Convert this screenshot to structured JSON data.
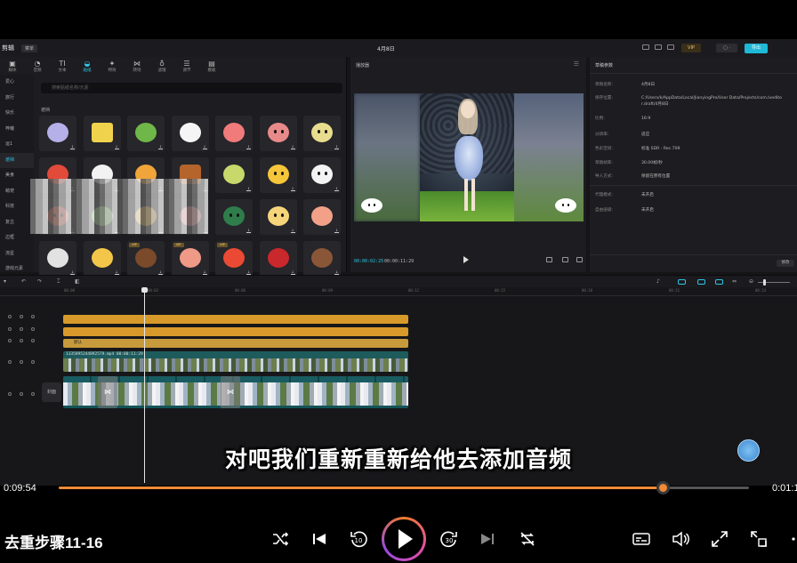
{
  "editor": {
    "app_name": "剪辑",
    "menu_chip": "菜单",
    "project_name": "4月8日",
    "vip_label": "VIP",
    "export_label": "导出",
    "asset_tabs": [
      "媒体",
      "音频",
      "文本",
      "贴纸",
      "特效",
      "转场",
      "滤镜",
      "调节",
      "模板"
    ],
    "asset_side": [
      "爱心",
      "旅行",
      "快乐",
      "梓曦",
      "运1",
      "遮挡",
      "美食",
      "萌宠",
      "科技",
      "复古",
      "边框",
      "流星",
      "游戏元素"
    ],
    "asset_section": "遮挡",
    "asset_search_placeholder": "搜索贴纸名称/元素",
    "player_header": "播放器",
    "player_time_current": "00:00:02:25",
    "player_time_total": "00:00:11:29",
    "props_header": "草稿参数",
    "props": [
      {
        "k": "草稿名称:",
        "v": "4月8日"
      },
      {
        "k": "保存位置:",
        "v": "C:/Users/k/AppData/Local/JianyingPro/User Data/Projects/com.lveditor.draft/4月8日"
      },
      {
        "k": "比例:",
        "v": "16:9"
      },
      {
        "k": "分辨率:",
        "v": "适应"
      },
      {
        "k": "色彩空间:",
        "v": "标准 SDR - Rec.709"
      },
      {
        "k": "草稿帧率:",
        "v": "30.00帧/秒"
      },
      {
        "k": "导入方式:",
        "v": "保留在原有位置"
      },
      {
        "k": "代理模式:",
        "v": "未开启"
      },
      {
        "k": "自由层级:",
        "v": "未开启"
      }
    ],
    "props_edit_label": "修改",
    "ruler_ticks": [
      "00:00",
      "00:03",
      "00:06",
      "00:09",
      "00:12",
      "00:15",
      "00:18",
      "00:21",
      "00:24"
    ],
    "text_clip_label": "默认",
    "video_clip_label": "1335895244892579.mp4  00:00:11:29",
    "cover_label": "封面"
  },
  "subtitle": "对吧我们重新重新给他去添加音频",
  "player": {
    "time_elapsed": "0:09:54",
    "time_total": "0:01:1",
    "progress": 0.875,
    "episode_title": "去重步骤11-16",
    "accent_color": "#f08a36"
  },
  "icons": [
    "shuffle-icon",
    "previous-icon",
    "rewind-10-icon",
    "play-icon",
    "forward-30-icon",
    "next-icon",
    "repeat-off-icon",
    "subtitles-icon",
    "volume-icon",
    "fullscreen-icon",
    "pip-icon",
    "more-icon"
  ]
}
